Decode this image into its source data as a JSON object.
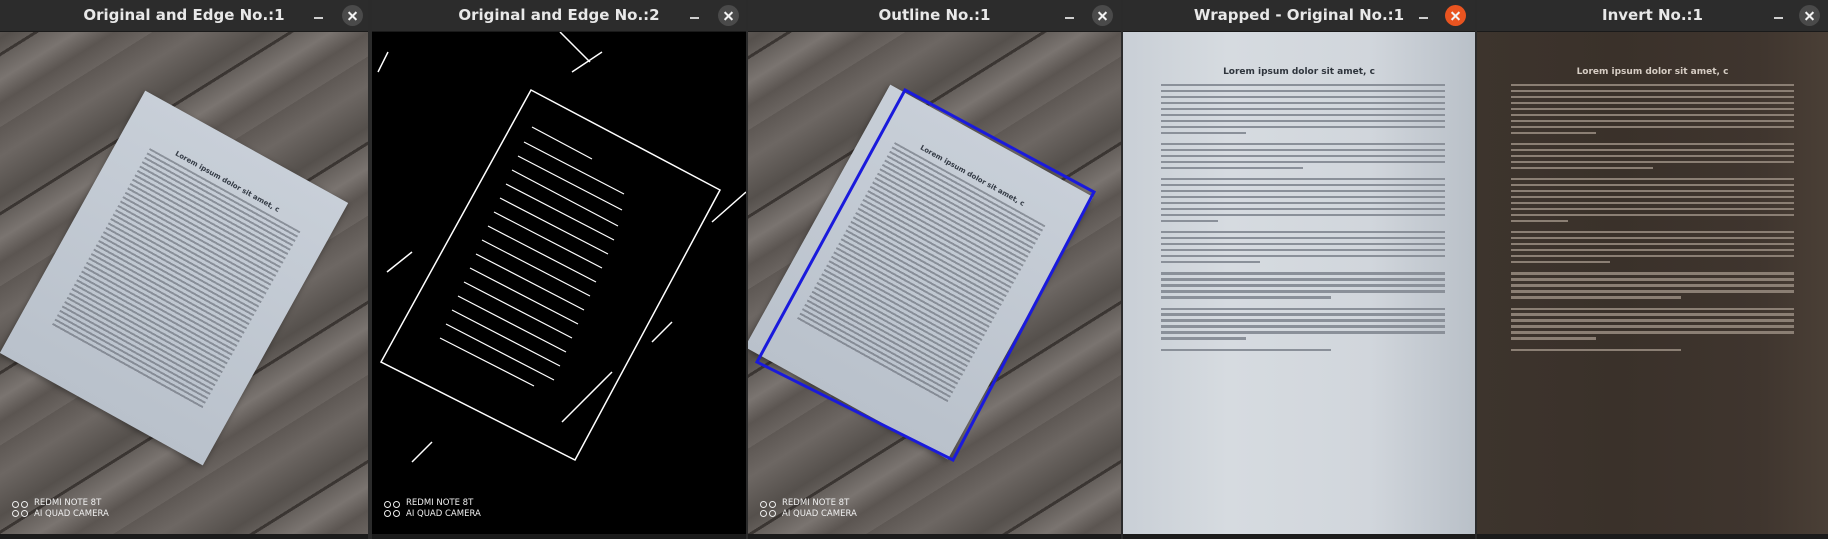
{
  "windows": [
    {
      "title": "Original and Edge No.:1",
      "watermark": {
        "line1": "REDMI NOTE 8T",
        "line2": "AI QUAD CAMERA"
      },
      "paper_title": "Lorem ipsum dolor sit amet, c"
    },
    {
      "title": "Original and Edge No.:2",
      "watermark": {
        "line1": "REDMI NOTE 8T",
        "line2": "AI QUAD CAMERA"
      }
    },
    {
      "title": "Outline No.:1",
      "watermark": {
        "line1": "REDMI NOTE 8T",
        "line2": "AI QUAD CAMERA"
      },
      "paper_title": "Lorem ipsum dolor sit amet, c"
    },
    {
      "title": "Wrapped - Original No.:1",
      "doc_title": "Lorem ipsum dolor sit amet, c"
    },
    {
      "title": "Invert  No.:1",
      "doc_title": "Lorem ipsum dolor sit amet, c"
    }
  ],
  "colors": {
    "close_active": "#e95420",
    "outline": "#1a1adc",
    "titlebar": "#2c2c2c"
  },
  "icons": {
    "minimize": "minimize-icon",
    "close": "close-icon",
    "camera": "camera-icon"
  }
}
